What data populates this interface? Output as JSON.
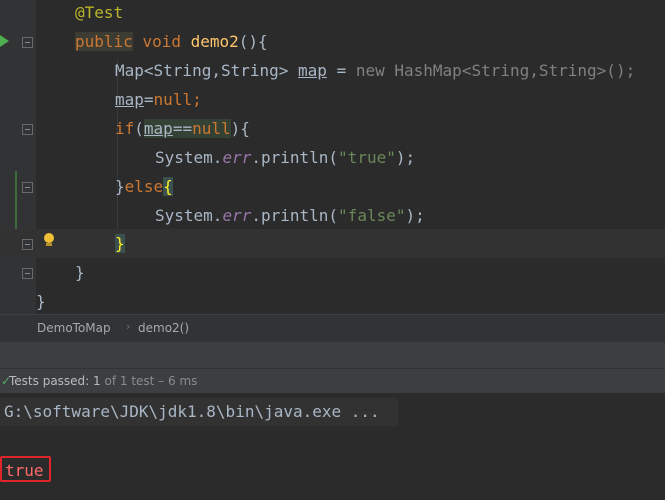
{
  "editor": {
    "lines": [
      {
        "annotation": "@Test"
      },
      {
        "kw_public": "public",
        "kw_void": "void",
        "method": "demo2",
        "rest": "(){"
      },
      {
        "type_decl": "Map<String,String> ",
        "var": "map",
        "assign": " = ",
        "kw_new": "new",
        "ctor": " HashMap<String,String>();"
      },
      {
        "var": "map",
        "assign": "=",
        "kw_null": "null",
        "semi": ";"
      },
      {
        "kw_if": "if",
        "paren_open": "(",
        "var": "map",
        "op": "==",
        "kw_null": "null",
        "paren_close": "){"
      },
      {
        "obj": "System.",
        "field": "err",
        "call": ".println(",
        "str": "\"true\"",
        "end": ");"
      },
      {
        "brace": "}",
        "kw_else": "else",
        "brace_open": "{"
      },
      {
        "obj": "System.",
        "field": "err",
        "call": ".println(",
        "str": "\"false\"",
        "end": ");"
      },
      {
        "brace": "}"
      },
      {
        "brace": "}"
      },
      {
        "brace": "}"
      }
    ]
  },
  "breadcrumb": {
    "class_name": "DemoToMap",
    "separator": "›",
    "method_name": "demo2()"
  },
  "run_panel": {
    "status_icon": "check-icon",
    "status_label": "Tests passed: ",
    "passed_count": "1",
    "status_rest": " of 1 test – 6 ms",
    "command": "G:\\software\\JDK\\jdk1.8\\bin\\java.exe ...",
    "output": "true"
  },
  "colors": {
    "background": "#2b2b2b",
    "keyword": "#cc7832",
    "string": "#6a8759",
    "error_output": "#ff6b68",
    "highlight_box": "#e0262a",
    "success": "#59a869"
  }
}
